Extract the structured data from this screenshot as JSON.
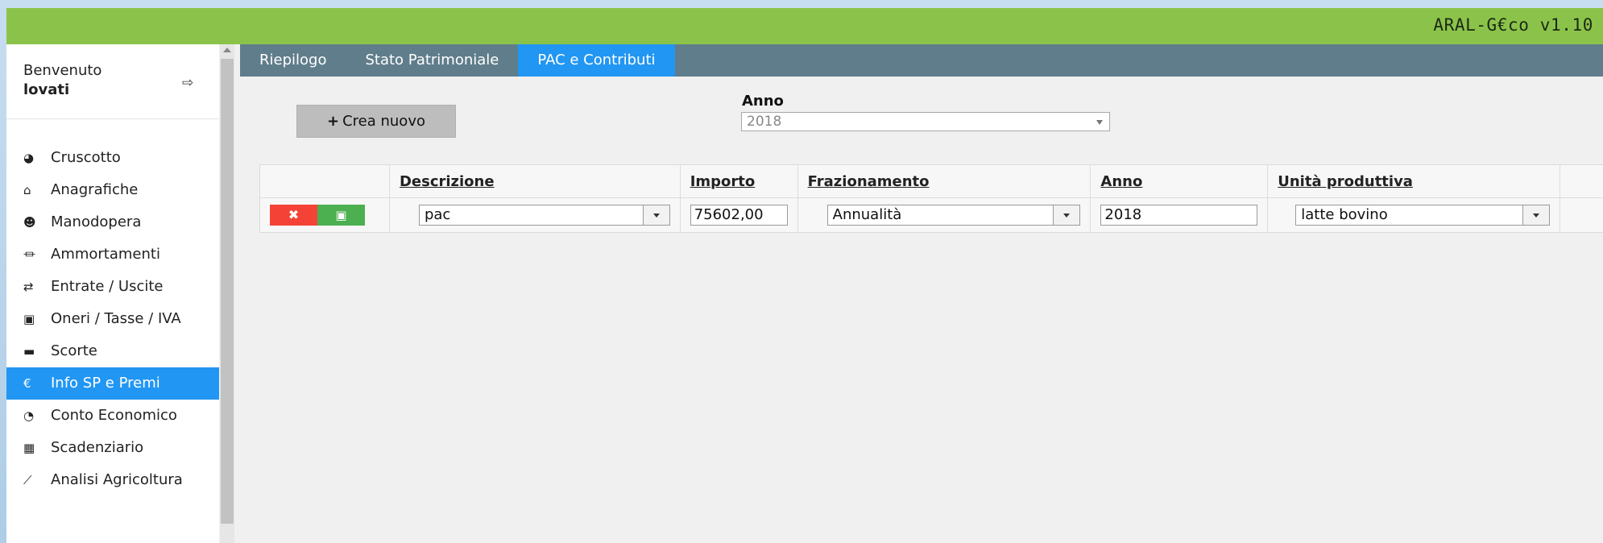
{
  "app": {
    "title": "ARAL-G€co v1.10"
  },
  "welcome": {
    "label": "Benvenuto",
    "user": "lovati"
  },
  "menu": [
    {
      "label": "Cruscotto",
      "icon": "dashboard-icon",
      "glyph": "◕"
    },
    {
      "label": "Anagrafiche",
      "icon": "home-icon",
      "glyph": "⌂"
    },
    {
      "label": "Manodopera",
      "icon": "users-icon",
      "glyph": "☻"
    },
    {
      "label": "Ammortamenti",
      "icon": "bank-icon",
      "glyph": "⏛"
    },
    {
      "label": "Entrate / Uscite",
      "icon": "exchange-icon",
      "glyph": "⇄"
    },
    {
      "label": "Oneri / Tasse / IVA",
      "icon": "money-icon",
      "glyph": "▣"
    },
    {
      "label": "Scorte",
      "icon": "archive-icon",
      "glyph": "▬"
    },
    {
      "label": "Info SP e Premi",
      "icon": "euro-icon",
      "glyph": "€"
    },
    {
      "label": "Conto Economico",
      "icon": "pie-chart-icon",
      "glyph": "◔"
    },
    {
      "label": "Scadenziario",
      "icon": "calendar-check-icon",
      "glyph": "▦"
    },
    {
      "label": "Analisi Agricoltura",
      "icon": "line-chart-icon",
      "glyph": "⟋"
    }
  ],
  "active_menu": "Info SP e Premi",
  "tabs": [
    "Riepilogo",
    "Stato Patrimoniale",
    "PAC e Contributi"
  ],
  "active_tab": "PAC e Contributi",
  "toolbar": {
    "create_label": "Crea nuovo"
  },
  "filter": {
    "anno_label": "Anno",
    "anno_value": "2018"
  },
  "table": {
    "headers": [
      "Descrizione",
      "Importo",
      "Frazionamento",
      "Anno",
      "Unità produttiva"
    ],
    "rows": [
      {
        "descrizione": "pac",
        "importo": "75602,00",
        "frazionamento": "Annualità",
        "anno": "2018",
        "unita": "latte bovino"
      }
    ]
  },
  "colors": {
    "topbar": "#8bc34a",
    "tabs_bg": "#607d8b",
    "accent": "#2196f3",
    "delete": "#f44336",
    "save": "#4caf50"
  }
}
